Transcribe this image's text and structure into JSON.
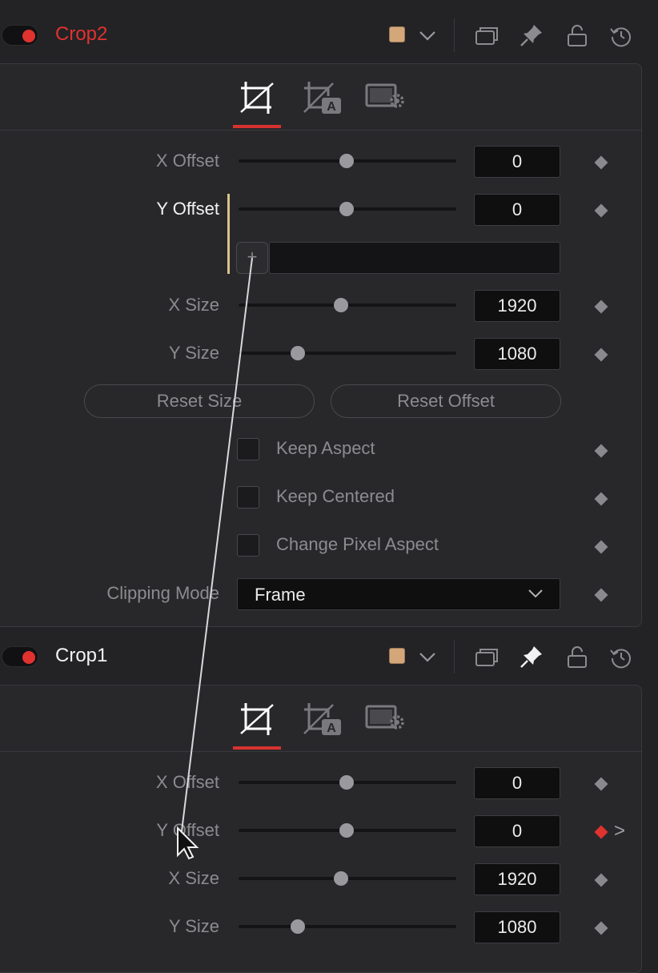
{
  "crop2": {
    "title": "Crop2",
    "title_color": "#e0322f",
    "swatch_color": "#d4a77a",
    "tabs": [
      "crop-tab-icon",
      "crop-auto-tab-icon",
      "settings-tab-icon"
    ],
    "params": {
      "x_offset": {
        "label": "X Offset",
        "value": "0"
      },
      "y_offset": {
        "label": "Y Offset",
        "value": "0"
      },
      "x_size": {
        "label": "X Size",
        "value": "1920"
      },
      "y_size": {
        "label": "Y Size",
        "value": "1080"
      }
    },
    "add_button": "+",
    "buttons": {
      "reset_size": "Reset Size",
      "reset_offset": "Reset Offset"
    },
    "checkboxes": {
      "keep_aspect": "Keep Aspect",
      "keep_centered": "Keep Centered",
      "change_pixel_aspect": "Change Pixel Aspect"
    },
    "clipping_mode": {
      "label": "Clipping Mode",
      "value": "Frame"
    }
  },
  "crop1": {
    "title": "Crop1",
    "title_color": "#f2f2f2",
    "swatch_color": "#d4a77a",
    "params": {
      "x_offset": {
        "label": "X Offset",
        "value": "0"
      },
      "y_offset": {
        "label": "Y Offset",
        "value": "0"
      },
      "x_size": {
        "label": "X Size",
        "value": "1920"
      },
      "y_size": {
        "label": "Y Size",
        "value": "1080"
      }
    },
    "keyframe_next": ">"
  },
  "colors": {
    "accent_red": "#e0322f",
    "link_line": "#d9c38a",
    "panel_bg": "#28282b"
  }
}
